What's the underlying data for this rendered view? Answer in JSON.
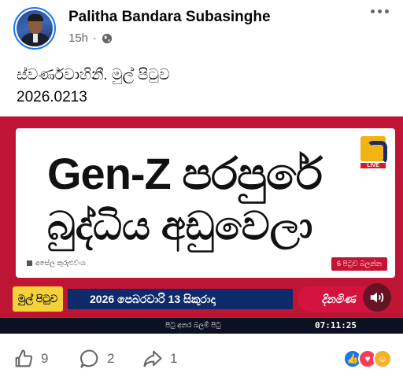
{
  "post": {
    "author": "Palitha Bandara Subasinghe",
    "time": "15h",
    "privacy_icon": "globe-icon",
    "text_line1": "ස්වර්ණවාහිනී. මුල් පිටුව",
    "text_line2": "2026.0213"
  },
  "media": {
    "headline1": "Gen-Z පරපුරේ",
    "headline2": "බුද්ධිය අඩුවෙලා",
    "logo_live": "LIVE",
    "author_credit": "අසේල කුරුළුවංශ",
    "more_tag": "6 පිටුව බලන්න",
    "strip_left": "මුල් පිටුව",
    "date_line": "2026 පෙබරවාරි 13 සිකුරාදා",
    "strip_right": "දිනමිණ",
    "ticker": "පිටු අනර බලම් පිටු",
    "clock": "07:11:25",
    "colors": {
      "background": "#bf1534",
      "bar": "#0d2a6b",
      "accent": "#f4d23a"
    }
  },
  "actions": {
    "like_count": "9",
    "comment_count": "2",
    "share_count": "1",
    "reaction_icons": [
      "like-reaction-icon",
      "love-reaction-icon",
      "care-reaction-icon"
    ]
  }
}
